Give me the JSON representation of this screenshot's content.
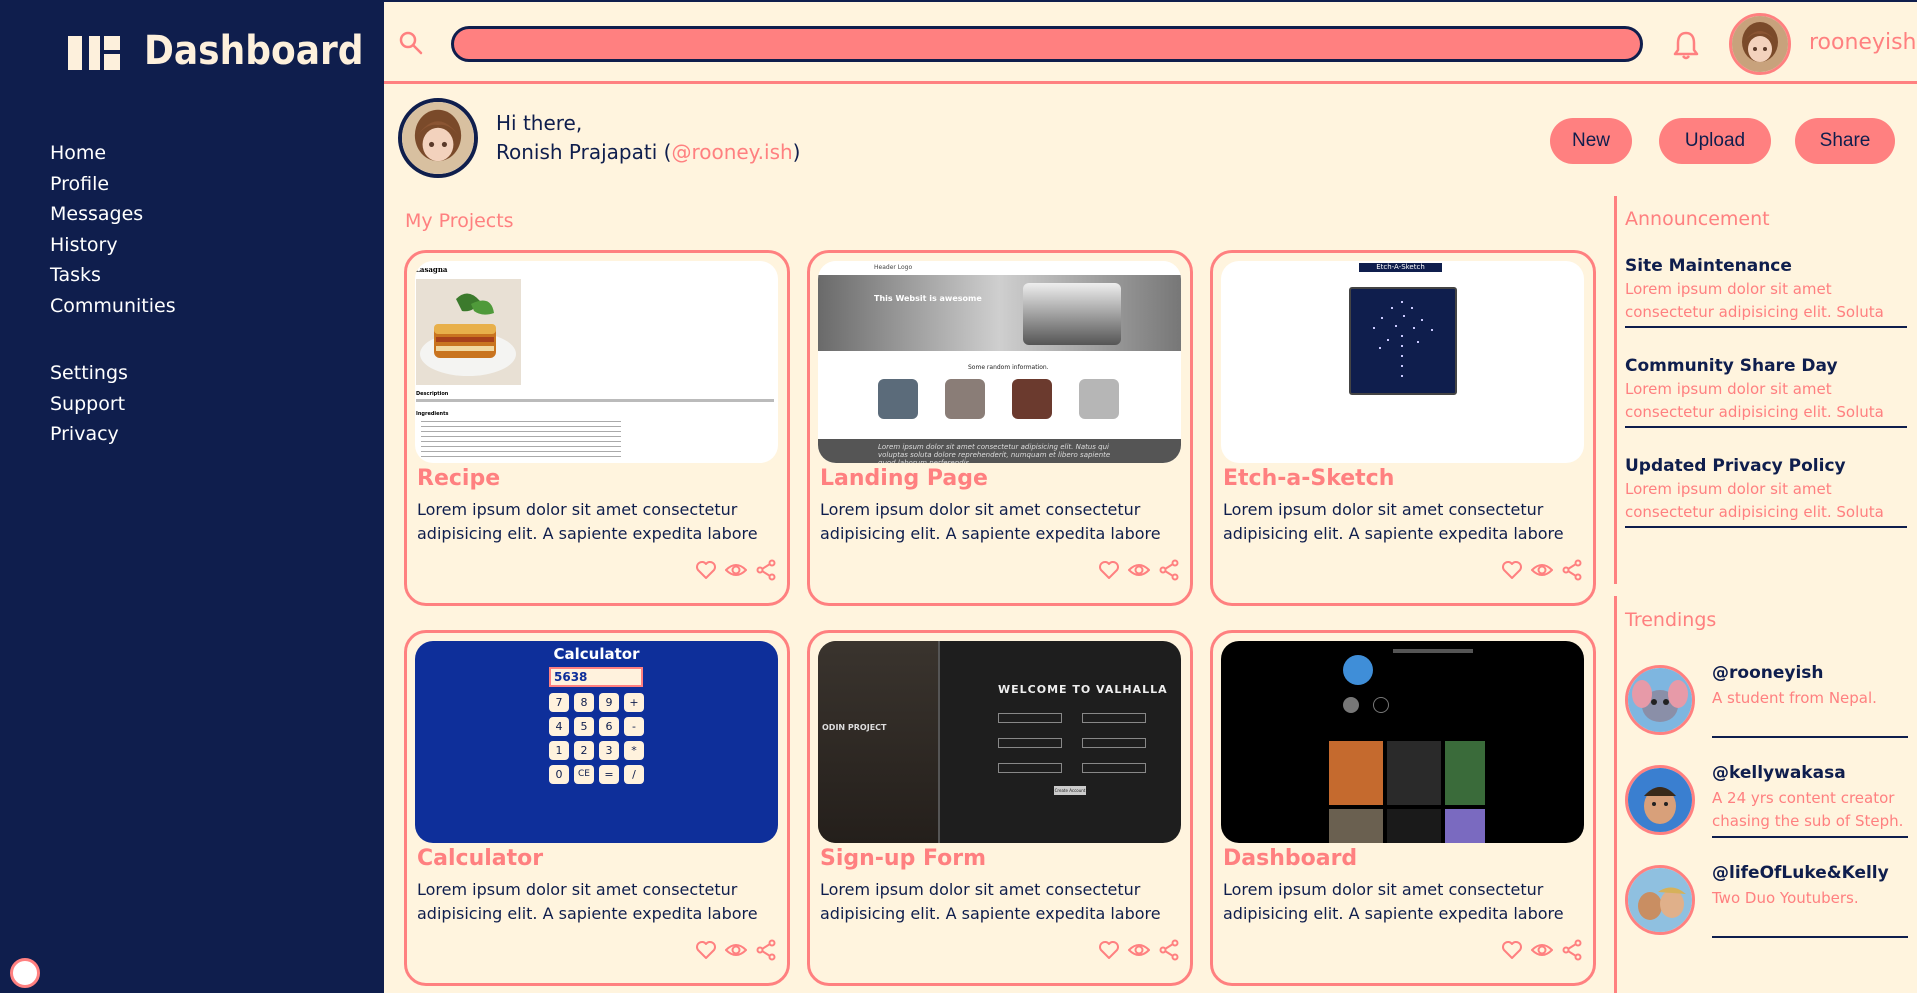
{
  "sidebar": {
    "logo_text": "Dashboard",
    "nav_primary": [
      "Home",
      "Profile",
      "Messages",
      "History",
      "Tasks",
      "Communities"
    ],
    "nav_secondary": [
      "Settings",
      "Support",
      "Privacy"
    ]
  },
  "topbar": {
    "search_value": "",
    "username": "rooneyish"
  },
  "greeting": {
    "line1": "Hi there,",
    "name": "Ronish Prajapati (",
    "handle": "@rooney.ish",
    "close": ")"
  },
  "actions": {
    "new": "New",
    "upload": "Upload",
    "share": "Share"
  },
  "projects": {
    "title": "My Projects",
    "cards": [
      {
        "title": "Recipe",
        "desc": "Lorem ipsum dolor sit amet consectetur adipisicing elit. A sapiente expedita labore"
      },
      {
        "title": "Landing Page",
        "desc": "Lorem ipsum dolor sit amet consectetur adipisicing elit. A sapiente expedita labore"
      },
      {
        "title": "Etch-a-Sketch",
        "desc": "Lorem ipsum dolor sit amet consectetur adipisicing elit. A sapiente expedita labore"
      },
      {
        "title": "Calculator",
        "desc": "Lorem ipsum dolor sit amet consectetur adipisicing elit. A sapiente expedita labore"
      },
      {
        "title": "Sign-up Form",
        "desc": "Lorem ipsum dolor sit amet consectetur adipisicing elit. A sapiente expedita labore"
      },
      {
        "title": "Dashboard",
        "desc": "Lorem ipsum dolor sit amet consectetur adipisicing elit. A sapiente expedita labore"
      }
    ]
  },
  "thumbs": {
    "recipe_heading": "Lasagna",
    "recipe_desc": "Description",
    "recipe_ingredients": "Ingredients",
    "landing_logo": "Header Logo",
    "landing_hero": "This Websit is awesome",
    "landing_info": "Some random information.",
    "landing_footer": "Lorem ipsum dolor sit amet consectetur adipisicing elit. Natus qui voluptas soluta dolore reprehenderit, numquam et libero sapiente quod laborum perferendis.",
    "etch_title": "Etch-A-Sketch",
    "calc_title": "Calculator",
    "calc_display": "5638",
    "calc_keys": [
      "7",
      "8",
      "9",
      "+",
      "4",
      "5",
      "6",
      "-",
      "1",
      "2",
      "3",
      "*",
      "0",
      "CE",
      "=",
      "/"
    ],
    "signup_title": "WELCOME TO VALHALLA",
    "signup_brand": "ODIN PROJECT",
    "signup_button": "Create Account"
  },
  "announcement": {
    "title": "Announcement",
    "items": [
      {
        "title": "Site Maintenance",
        "text": "Lorem ipsum dolor sit amet consectetur adipisicing elit. Soluta"
      },
      {
        "title": "Community Share Day",
        "text": "Lorem ipsum dolor sit amet consectetur adipisicing elit. Soluta"
      },
      {
        "title": "Updated Privacy Policy",
        "text": "Lorem ipsum dolor sit amet consectetur adipisicing elit. Soluta"
      }
    ]
  },
  "trendings": {
    "title": "Trendings",
    "items": [
      {
        "handle": "@rooneyish",
        "desc": "A student from Nepal."
      },
      {
        "handle": "@kellywakasa",
        "desc": "A 24 yrs content creator chasing the sub of Steph."
      },
      {
        "handle": "@lifeOfLuke&Kelly",
        "desc": "Two Duo Youtubers."
      }
    ]
  },
  "colors": {
    "navy": "#0f1e4d",
    "coral": "#ff8080",
    "cream": "#fff4de"
  },
  "icons": [
    "search-icon",
    "bell-icon",
    "heart-icon",
    "eye-icon",
    "share-icon",
    "dashboard-logo-icon"
  ]
}
